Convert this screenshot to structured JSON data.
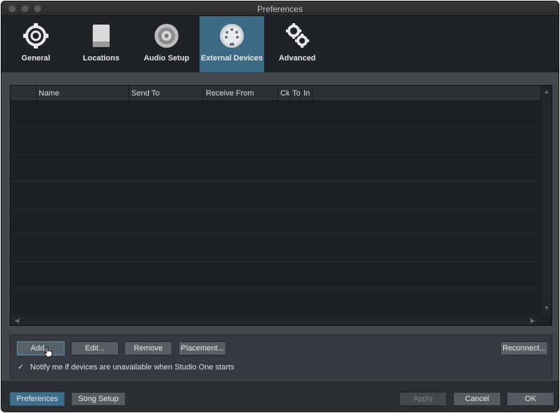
{
  "window": {
    "title": "Preferences"
  },
  "toolbar": {
    "tabs": [
      {
        "label": "General",
        "icon": "gear-cycle-icon"
      },
      {
        "label": "Locations",
        "icon": "drive-icon"
      },
      {
        "label": "Audio Setup",
        "icon": "speaker-icon"
      },
      {
        "label": "External Devices",
        "icon": "midi-port-icon",
        "active": true
      },
      {
        "label": "Advanced",
        "icon": "gears-icon"
      }
    ]
  },
  "table": {
    "columns": [
      "Name",
      "Send To",
      "Receive From",
      "Ck",
      "To",
      "In"
    ],
    "rows": []
  },
  "actions": {
    "add": "Add...",
    "edit": "Edit...",
    "remove": "Remove",
    "placement": "Placement...",
    "reconnect": "Reconnect..."
  },
  "notify": {
    "checked": true,
    "label": "Notify me if devices are unavailable when Studio One starts"
  },
  "footer": {
    "preferences": "Preferences",
    "song_setup": "Song Setup",
    "apply": "Apply",
    "cancel": "Cancel",
    "ok": "OK"
  },
  "colors": {
    "accent": "#3d6b86",
    "background": "#43464b",
    "table_bg": "#1d2024"
  }
}
